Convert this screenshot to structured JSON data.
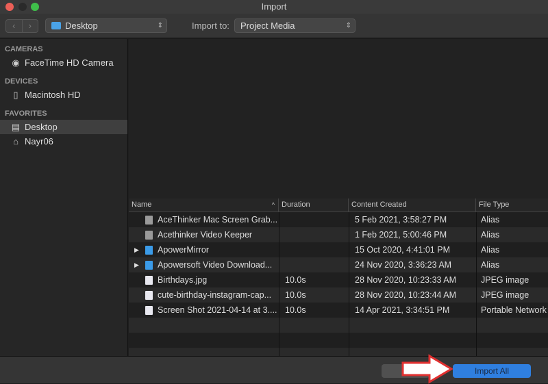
{
  "window": {
    "title": "Import"
  },
  "toolbar": {
    "location": "Desktop",
    "import_to_label": "Import to:",
    "import_to_value": "Project Media"
  },
  "sidebar": {
    "sections": [
      {
        "title": "CAMERAS",
        "items": [
          {
            "label": "FaceTime HD Camera",
            "icon": "camera-icon"
          }
        ]
      },
      {
        "title": "DEVICES",
        "items": [
          {
            "label": "Macintosh HD",
            "icon": "hard-drive-icon"
          }
        ]
      },
      {
        "title": "FAVORITES",
        "items": [
          {
            "label": "Desktop",
            "icon": "desktop-icon",
            "selected": true
          },
          {
            "label": "Nayr06",
            "icon": "home-icon"
          }
        ]
      }
    ]
  },
  "table": {
    "columns": [
      "Name",
      "Duration",
      "Content Created",
      "File Type"
    ],
    "sort": "Name ascending",
    "rows": [
      {
        "name": "AceThinker Mac Screen Grab...",
        "duration": "",
        "created": "5 Feb 2021, 3:58:27 PM",
        "type": "Alias",
        "icon": "alias-icon",
        "expandable": false
      },
      {
        "name": "Acethinker Video Keeper",
        "duration": "",
        "created": "1 Feb 2021, 5:00:46 PM",
        "type": "Alias",
        "icon": "alias-icon",
        "expandable": false
      },
      {
        "name": "ApowerMirror",
        "duration": "",
        "created": "15 Oct 2020, 4:41:01 PM",
        "type": "Alias",
        "icon": "app-icon",
        "expandable": true
      },
      {
        "name": "Apowersoft Video Download...",
        "duration": "",
        "created": "24 Nov 2020, 3:36:23 AM",
        "type": "Alias",
        "icon": "app-icon",
        "expandable": true
      },
      {
        "name": "Birthdays.jpg",
        "duration": "10.0s",
        "created": "28 Nov 2020, 10:23:33 AM",
        "type": "JPEG image",
        "icon": "image-file-icon",
        "expandable": false
      },
      {
        "name": "cute-birthday-instagram-cap...",
        "duration": "10.0s",
        "created": "28 Nov 2020, 10:23:44 AM",
        "type": "JPEG image",
        "icon": "image-file-icon",
        "expandable": false
      },
      {
        "name": "Screen Shot 2021-04-14 at 3....",
        "duration": "10.0s",
        "created": "14 Apr 2021, 3:34:51 PM",
        "type": "Portable Network",
        "icon": "image-file-icon",
        "expandable": false
      }
    ]
  },
  "footer": {
    "import_all": "Import All"
  },
  "colors": {
    "accent": "#2f7fe0",
    "annotation_arrow": "#e03030"
  }
}
